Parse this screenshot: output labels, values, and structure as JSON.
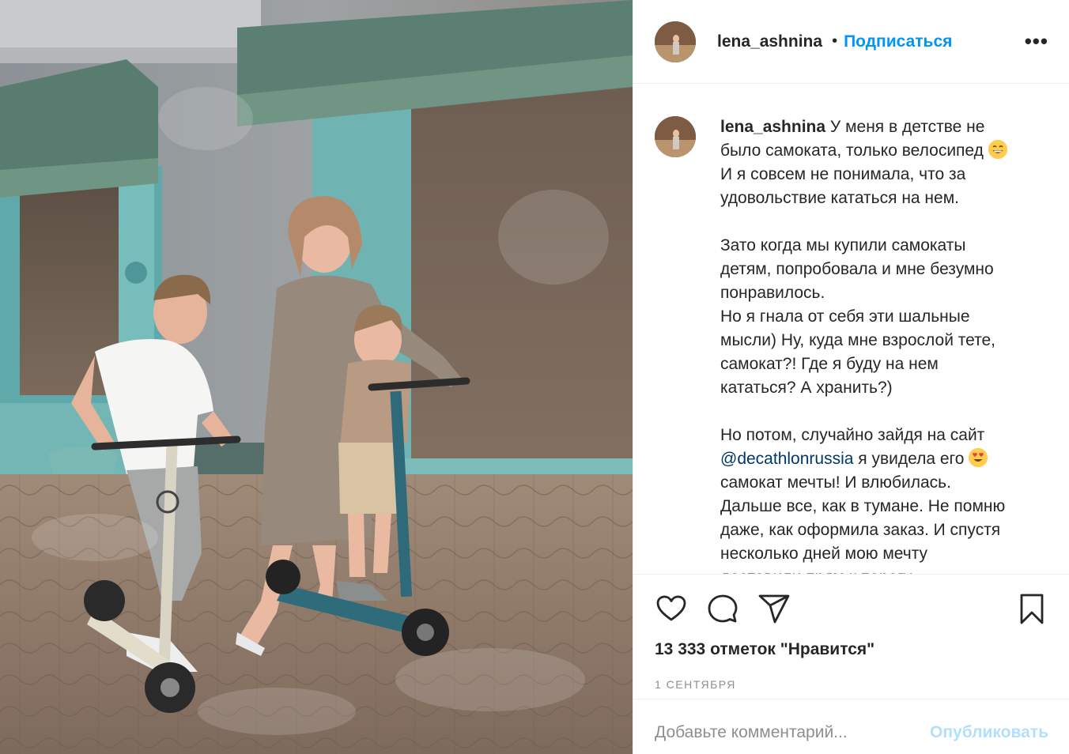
{
  "photo": {
    "icon": "family-scooter-photo"
  },
  "header": {
    "username": "lena_ashnina",
    "separator": "•",
    "follow_label": "Подписаться",
    "more_label": "•••"
  },
  "caption": {
    "username": "lena_ashnina",
    "lines": [
      "У меня в детстве не",
      "было самоката, только велосипед",
      "И я совсем не понимала, что за",
      "удовольствие кататься на нем.",
      "Зато когда мы купили самокаты",
      "детям, попробовала и мне безумно",
      "понравилось.",
      "Но я гнала от себя эти шальные",
      "мысли) Ну, куда мне взрослой тете,",
      "самокат?! Где я буду на нем",
      "кататься? А хранить?)",
      "Но потом, случайно зайдя на сайт",
      "@decathlonrussia",
      "я увидела его",
      "самокат мечты! И влюбилась.",
      "Дальше все, как в тумане. Не помню",
      "даже, как оформила заказ. И спустя",
      "несколько дней мою мечту",
      "доставили прям к порогу"
    ],
    "emoji_1": "grinning-face-emoji",
    "emoji_2": "heart-eyes-emoji"
  },
  "actions": {
    "like_icon": "heart-icon",
    "comment_icon": "comment-icon",
    "share_icon": "paper-plane-icon",
    "save_icon": "bookmark-icon"
  },
  "likes_text": "13 333 отметок \"Нравится\"",
  "date_text": "1 СЕНТЯБРЯ",
  "comment": {
    "placeholder": "Добавьте комментарий...",
    "publish_label": "Опубликовать"
  },
  "colors": {
    "link_blue": "#0095f6",
    "mention": "#00376b",
    "publish_disabled": "#b2dffc",
    "muted": "#8e8e8e"
  }
}
